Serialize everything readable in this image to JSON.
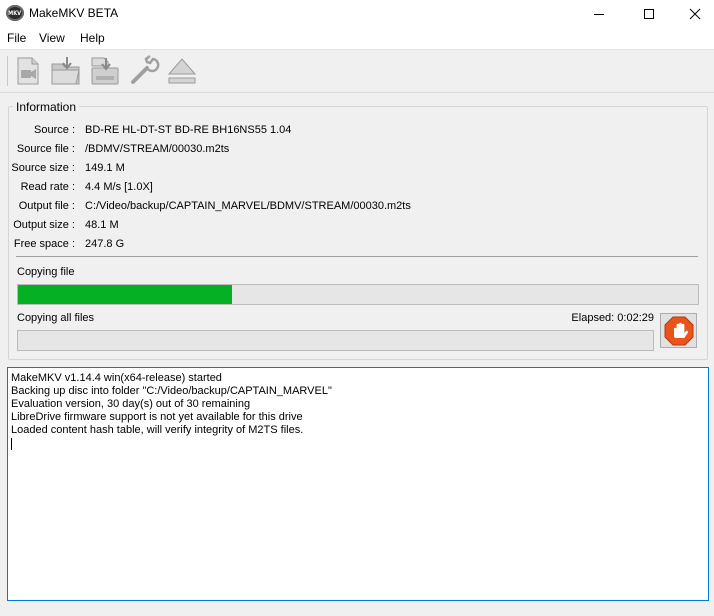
{
  "window": {
    "title": "MakeMKV BETA",
    "icon_text": "MKV"
  },
  "menu": {
    "items": [
      "File",
      "View",
      "Help"
    ]
  },
  "toolbar": {
    "icons": [
      "open-files-icon",
      "open-disc-icon",
      "backup-icon",
      "settings-wrench-icon",
      "eject-icon"
    ]
  },
  "info": {
    "title": "Information",
    "rows": [
      {
        "label": "Source :",
        "value": "BD-RE HL-DT-ST BD-RE  BH16NS55 1.04"
      },
      {
        "label": "Source file :",
        "value": "/BDMV/STREAM/00030.m2ts"
      },
      {
        "label": "Source size :",
        "value": "149.1 M"
      },
      {
        "label": "Read rate :",
        "value": "4.4 M/s [1.0X]"
      },
      {
        "label": "Output file :",
        "value": "C:/Video/backup/CAPTAIN_MARVEL/BDMV/STREAM/00030.m2ts"
      },
      {
        "label": "Output size :",
        "value": "48.1 M"
      },
      {
        "label": "Free space :",
        "value": "247.8 G"
      }
    ]
  },
  "progress": {
    "file_label": "Copying file",
    "file_fraction": 0.315,
    "total_label": "Copying all files",
    "total_fraction": 0,
    "elapsed": "Elapsed: 0:02:29",
    "fill_color": "#06b025"
  },
  "log": {
    "lines": [
      "MakeMKV v1.14.4 win(x64-release) started",
      "Backing up disc into folder \"C:/Video/backup/CAPTAIN_MARVEL\"",
      "Evaluation version, 30 day(s) out of 30 remaining",
      "LibreDrive firmware support is not yet available for this drive",
      "Loaded content hash table, will verify integrity of M2TS files."
    ]
  }
}
